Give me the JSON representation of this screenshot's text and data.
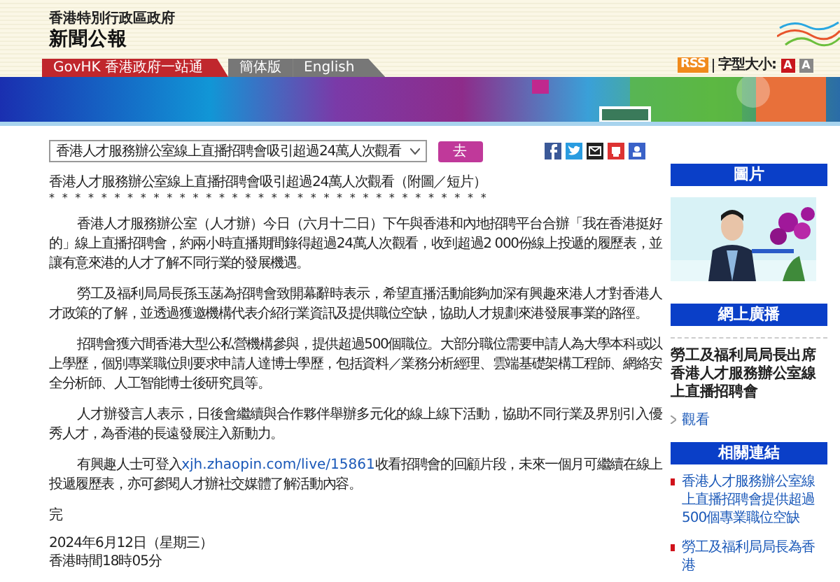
{
  "header": {
    "agency": "香港特別行政區政府",
    "title": "新聞公報",
    "nav": [
      {
        "label": "GovHK 香港政府一站通",
        "selected": true
      },
      {
        "label": "簡体版",
        "selected": false
      },
      {
        "label": "English",
        "selected": false
      }
    ],
    "rss": "RSS",
    "font_size_label": "字型大小:",
    "font_buttons": [
      {
        "label": "A",
        "selected": true
      },
      {
        "label": "A",
        "selected": false
      }
    ]
  },
  "toolbar": {
    "article_select": {
      "value": "香港人才服務辦公室線上直播招聘會吸引超過24萬人次觀看"
    },
    "go_button": "去"
  },
  "article": {
    "title": "香港人才服務辦公室線上直播招聘會吸引超過24萬人次觀看（附圖／短片）",
    "separator": "* * * * * * * * * * * * * * * * * * * * * * * * * * * * * * * * * *",
    "paragraphs": [
      {
        "text": "香港人才服務辦公室（人才辦）今日（六月十二日）下午與香港和內地招聘平台合辦「我在香港挺好的」線上直播招聘會，約兩小時直播期間錄得超過24萬人次觀看，收到超過2 000份線上投遞的履歷表，並讓有意來港的人才了解不同行業的發展機遇。"
      },
      {
        "text": "勞工及福利局局長孫玉菡為招聘會致開幕辭時表示，希望直播活動能夠加深有興趣來港人才對香港人才政策的了解，並透過獲邀機構代表介紹行業資訊及提供職位空缺，協助人才規劃來港發展事業的路徑。"
      },
      {
        "text": "招聘會獲六間香港大型公私營機構參與，提供超過500個職位。大部分職位需要申請人為大學本科或以上學歷，個別專業職位則要求申請人達博士學歷，包括資料／業務分析經理、雲端基礎架構工程師、網絡安全分析師、人工智能博士後研究員等。"
      },
      {
        "text": "人才辦發言人表示，日後會繼續與合作夥伴舉辦多元化的線上線下活動，協助不同行業及界別引入優秀人才，為香港的長遠發展注入新動力。"
      },
      {
        "text": "有興趣人士可登入",
        "link": "xjh.zhaopin.com/live/15861",
        "after": "收看招聘會的回顧片段，未來一個月可繼續在線上投遞履歷表，亦可參閱人才辦社交媒體了解活動內容。"
      }
    ],
    "end": "完",
    "date": "2024年6月12日（星期三）",
    "time": "香港時間18時05分"
  },
  "sidebar": {
    "photo_heading": "圖片",
    "photo": {
      "kind": "picture"
    },
    "webcast_heading": "網上廣播",
    "webcast_title": "勞工及福利局局長出席香港人才服務辦公室線上直播招聘會",
    "watch_link": "觀看",
    "related_heading": "相關連結",
    "related_links": [
      "香港人才服務辦公室線上直播招聘會提供超過500個專業職位空缺",
      "勞工及福利局局長為香港"
    ]
  }
}
